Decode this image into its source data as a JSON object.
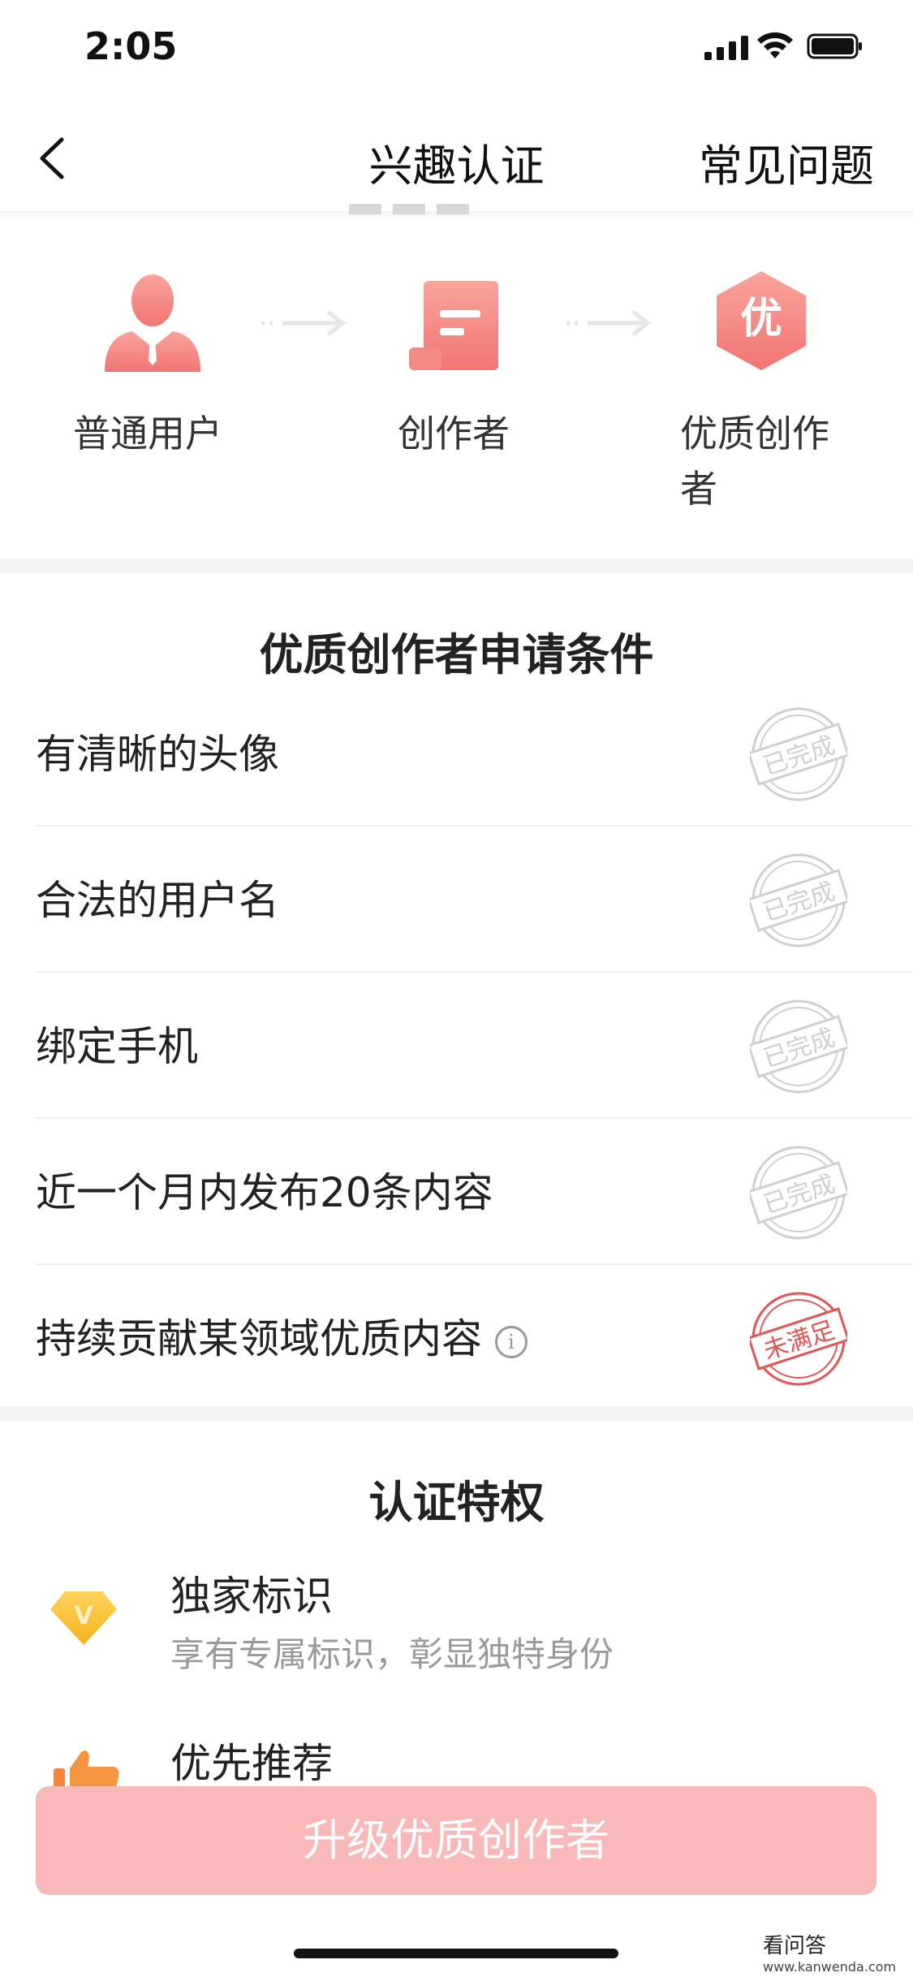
{
  "status_bar": {
    "time": "2:05"
  },
  "nav": {
    "title": "兴趣认证",
    "faq": "常见问题"
  },
  "steps": [
    {
      "label": "普通用户",
      "icon": "user-icon"
    },
    {
      "label": "创作者",
      "icon": "document-icon"
    },
    {
      "label_line1": "优质创作",
      "label_line2": "者",
      "icon": "quality-badge-icon",
      "badge_char": "优"
    }
  ],
  "conditions": {
    "title": "优质创作者申请条件",
    "items": [
      {
        "label": "有清晰的头像",
        "status": "已完成"
      },
      {
        "label": "合法的用户名",
        "status": "已完成"
      },
      {
        "label": "绑定手机",
        "status": "已完成"
      },
      {
        "label": "近一个月内发布20条内容",
        "status": "已完成"
      },
      {
        "label": "持续贡献某领域优质内容",
        "status": "未满足",
        "info_icon": "i"
      }
    ]
  },
  "privileges": {
    "title": "认证特权",
    "items": [
      {
        "title": "独家标识",
        "subtitle": "享有专属标识，彰显独特身份",
        "icon": "diamond-v-icon",
        "icon_char": "V"
      },
      {
        "title": "优先推荐",
        "icon": "thumbs-up-icon"
      }
    ]
  },
  "cta": {
    "label": "升级优质创作者"
  },
  "watermark": {
    "brand": "看问答",
    "site": "www.kanwenda.com"
  },
  "colors": {
    "accent": "#f47a78",
    "cta_bg": "#f9b9b9",
    "stamp_done": "#cfcfcf",
    "stamp_pending": "#e25555"
  }
}
